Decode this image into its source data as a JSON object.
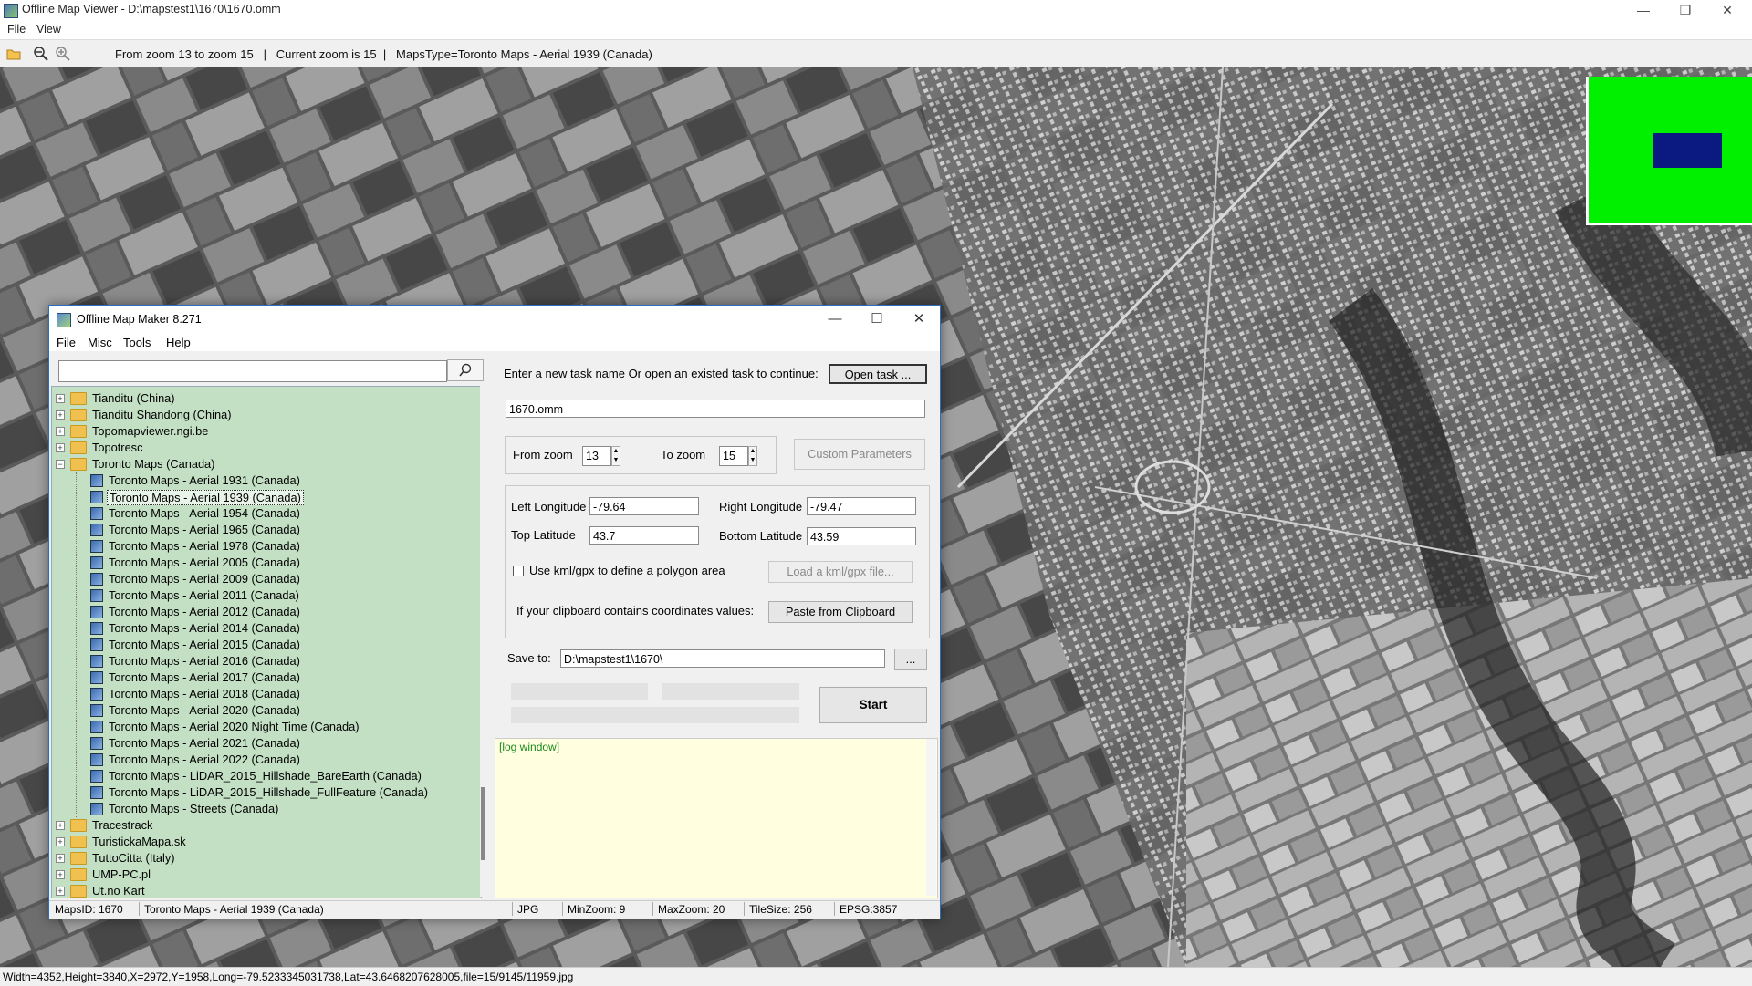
{
  "window": {
    "title": "Offline Map Viewer - D:\\mapstest1\\1670\\1670.omm",
    "menu": [
      "File",
      "View"
    ]
  },
  "toolbar": {
    "info": "From zoom 13 to zoom 15   |   Current zoom is 15  |   MapsType=Toronto Maps - Aerial 1939 (Canada)"
  },
  "status_main": "Width=4352,Height=3840,X=2972,Y=1958,Long=-79.5233345031738,Lat=43.6468207628005,file=15/9145/11959.jpg",
  "dialog": {
    "title": "Offline Map Maker 8.271",
    "menu": [
      "File",
      "Misc",
      "Tools",
      "Help"
    ],
    "search_value": "",
    "tree": [
      {
        "type": "folder",
        "label": "Tianditu (China)",
        "expanded": false
      },
      {
        "type": "folder",
        "label": "Tianditu Shandong (China)",
        "expanded": false
      },
      {
        "type": "folder",
        "label": "Topomapviewer.ngi.be",
        "expanded": false
      },
      {
        "type": "folder",
        "label": "Topotresc",
        "expanded": false
      },
      {
        "type": "folder",
        "label": "Toronto Maps (Canada)",
        "expanded": true
      },
      {
        "type": "map",
        "label": "Toronto Maps - Aerial 1931 (Canada)"
      },
      {
        "type": "map",
        "label": "Toronto Maps - Aerial 1939 (Canada)",
        "selected": true
      },
      {
        "type": "map",
        "label": "Toronto Maps - Aerial 1954 (Canada)"
      },
      {
        "type": "map",
        "label": "Toronto Maps - Aerial 1965 (Canada)"
      },
      {
        "type": "map",
        "label": "Toronto Maps - Aerial 1978 (Canada)"
      },
      {
        "type": "map",
        "label": "Toronto Maps - Aerial 2005 (Canada)"
      },
      {
        "type": "map",
        "label": "Toronto Maps - Aerial 2009 (Canada)"
      },
      {
        "type": "map",
        "label": "Toronto Maps - Aerial 2011 (Canada)"
      },
      {
        "type": "map",
        "label": "Toronto Maps - Aerial 2012 (Canada)"
      },
      {
        "type": "map",
        "label": "Toronto Maps - Aerial 2014 (Canada)"
      },
      {
        "type": "map",
        "label": "Toronto Maps - Aerial 2015 (Canada)"
      },
      {
        "type": "map",
        "label": "Toronto Maps - Aerial 2016 (Canada)"
      },
      {
        "type": "map",
        "label": "Toronto Maps - Aerial 2017 (Canada)"
      },
      {
        "type": "map",
        "label": "Toronto Maps - Aerial 2018 (Canada)"
      },
      {
        "type": "map",
        "label": "Toronto Maps - Aerial 2020 (Canada)"
      },
      {
        "type": "map",
        "label": "Toronto Maps - Aerial 2020 Night Time (Canada)"
      },
      {
        "type": "map",
        "label": "Toronto Maps - Aerial 2021 (Canada)"
      },
      {
        "type": "map",
        "label": "Toronto Maps - Aerial 2022 (Canada)"
      },
      {
        "type": "map",
        "label": "Toronto Maps - LiDAR_2015_Hillshade_BareEarth (Canada)"
      },
      {
        "type": "map",
        "label": "Toronto Maps - LiDAR_2015_Hillshade_FullFeature (Canada)"
      },
      {
        "type": "map",
        "label": "Toronto Maps - Streets (Canada)"
      },
      {
        "type": "folder",
        "label": "Tracestrack",
        "expanded": false
      },
      {
        "type": "folder",
        "label": "TuristickaMapa.sk",
        "expanded": false
      },
      {
        "type": "folder",
        "label": "TuttoCitta (Italy)",
        "expanded": false
      },
      {
        "type": "folder",
        "label": "UMP-PC.pl",
        "expanded": false
      },
      {
        "type": "folder",
        "label": "Ut.no Kart",
        "expanded": false
      }
    ],
    "task_prompt": "Enter a new task name Or open an existed task to continue:",
    "open_task_label": "Open task ...",
    "task_name": "1670.omm",
    "from_zoom_label": "From zoom",
    "from_zoom": "13",
    "to_zoom_label": "To zoom",
    "to_zoom": "15",
    "custom_params_label": "Custom Parameters",
    "left_lon_label": "Left Longitude",
    "left_lon": "-79.64",
    "right_lon_label": "Right Longitude",
    "right_lon": "-79.47",
    "top_lat_label": "Top Latitude",
    "top_lat": "43.7",
    "bottom_lat_label": "Bottom Latitude",
    "bottom_lat": "43.59",
    "kml_label": "Use kml/gpx to define a polygon area",
    "load_kml_label": "Load a kml/gpx file...",
    "clipboard_prompt": "If your clipboard contains coordinates values:",
    "paste_label": "Paste from Clipboard",
    "save_to_label": "Save to:",
    "save_to": "D:\\mapstest1\\1670\\",
    "browse_label": "...",
    "start_label": "Start",
    "log_text": "[log window]",
    "status": {
      "maps_id": "MapsID: 1670",
      "map_name": "Toronto Maps - Aerial 1939 (Canada)",
      "format": "JPG",
      "min_zoom": "MinZoom: 9",
      "max_zoom": "MaxZoom: 20",
      "tile_size": "TileSize: 256",
      "epsg": "EPSG:3857"
    }
  },
  "colors": {
    "tree_bg": "#c3dfc4",
    "overview_bg": "#00f000",
    "overview_view": "#0a1a80",
    "log_bg": "#ffffe0"
  }
}
